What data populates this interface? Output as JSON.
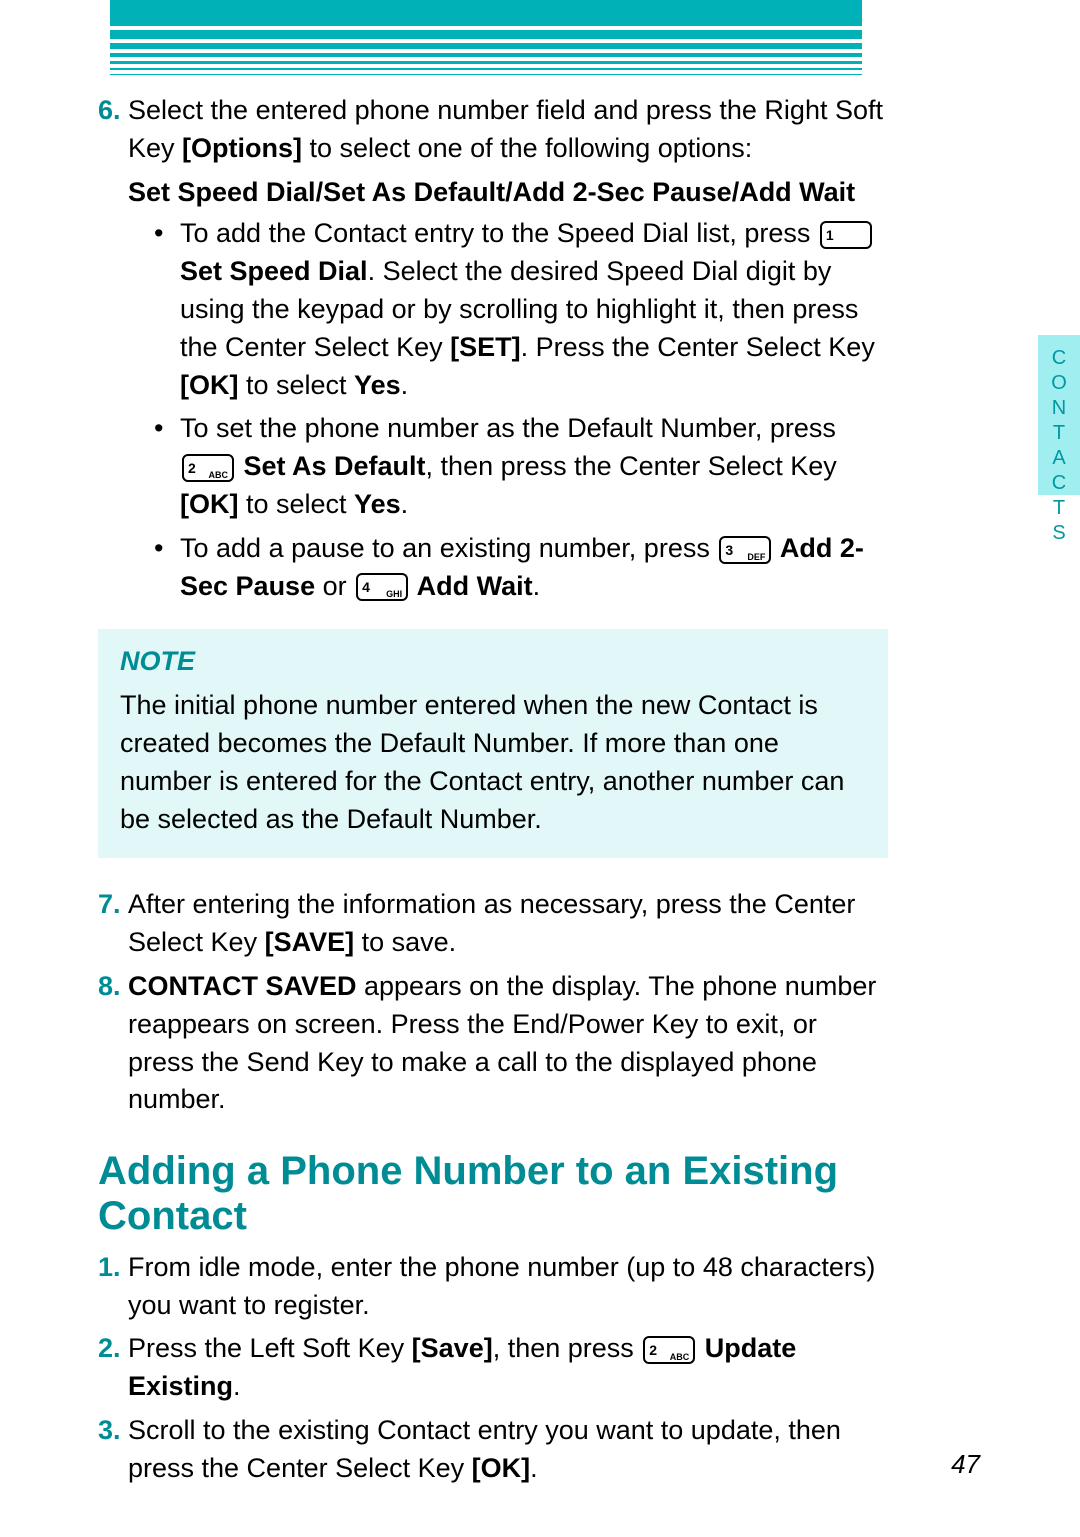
{
  "sideTab": "CONTACTS",
  "pageNumber": "47",
  "step6": {
    "num": "6.",
    "line1a": "Select the entered phone number field and press the Right Soft Key ",
    "options": "[Options]",
    "line1b": " to select one of the following options:",
    "boldLine": "Set Speed Dial/Set As Default/Add 2-Sec Pause/Add Wait"
  },
  "bullet1": {
    "t1": "To add the Contact entry to the Speed Dial list, press ",
    "key1_num": "1",
    "key1_sub": "",
    "b1a": " Set Speed Dial",
    "t2": ". Select the desired Speed Dial digit by using the keypad or by scrolling to highlight it, then press the Center Select Key ",
    "b2": "[SET]",
    "t3": ". Press the Center Select Key ",
    "b3": "[OK]",
    "t4": " to select ",
    "b4": "Yes",
    "t5": "."
  },
  "bullet2": {
    "t1": "To set the phone number as the Default Number, press ",
    "key_num": "2",
    "key_sub": "ABC",
    "b1a": " Set As Default",
    "t2": ", then press the Center Select Key ",
    "b2": "[OK]",
    "t3": " to select ",
    "b3": "Yes",
    "t4": "."
  },
  "bullet3": {
    "t1": "To add a pause to an existing number, press ",
    "key3_num": "3",
    "key3_sub": "DEF",
    "b1": " Add 2-Sec Pause",
    "t2": " or ",
    "key4_num": "4",
    "key4_sub": "GHI",
    "b2": " Add Wait",
    "t3": "."
  },
  "note": {
    "title": "NOTE",
    "body": "The initial phone number entered when the new Contact is created becomes the Default Number. If more than one number is entered for the Contact entry, another number can be selected as the Default Number."
  },
  "step7": {
    "num": "7.",
    "t1": "After entering the information as necessary, press the Center Select Key ",
    "b1": "[SAVE]",
    "t2": " to save."
  },
  "step8": {
    "num": "8.",
    "b1": "CONTACT SAVED",
    "t1": " appears on the display. The phone number reappears on screen. Press the End/Power Key to exit, or press the Send Key to make a call to the displayed phone number."
  },
  "section2": {
    "heading": "Adding a Phone Number to an Existing Contact"
  },
  "s2step1": {
    "num": "1.",
    "t1": "From idle mode, enter the phone number (up to 48 characters) you want to register."
  },
  "s2step2": {
    "num": "2.",
    "t1": "Press the Left Soft Key ",
    "b1": "[Save]",
    "t2": ", then press ",
    "key_num": "2",
    "key_sub": "ABC",
    "b2": " Update Existing",
    "t3": "."
  },
  "s2step3": {
    "num": "3.",
    "t1": "Scroll to the existing Contact entry you want to update, then press the Center Select Key ",
    "b1": "[OK]",
    "t2": "."
  }
}
